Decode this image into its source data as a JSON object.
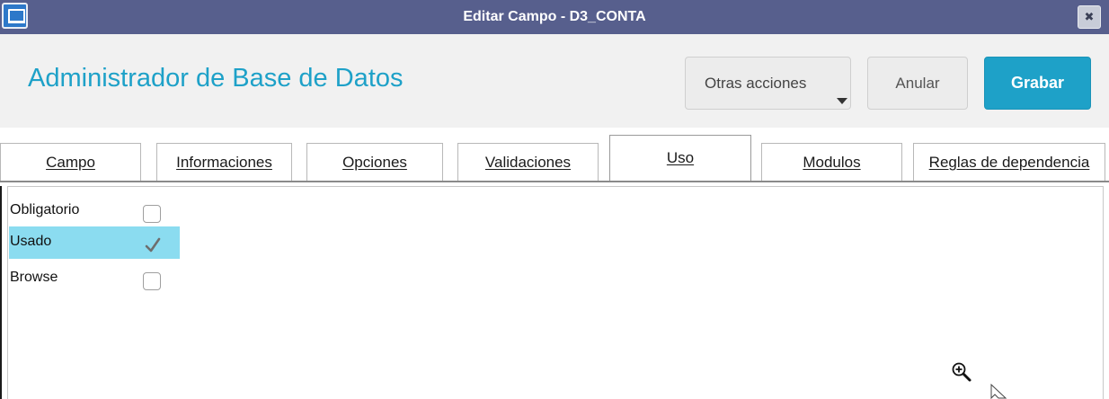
{
  "window": {
    "title": "Editar Campo - D3_CONTA",
    "close_label": "✖"
  },
  "header": {
    "title": "Administrador de Base de Datos",
    "buttons": {
      "more_actions": "Otras acciones",
      "cancel": "Anular",
      "save": "Grabar"
    }
  },
  "tabs": [
    {
      "label": "Campo",
      "active": false
    },
    {
      "label": "Informaciones",
      "active": false
    },
    {
      "label": "Opciones",
      "active": false
    },
    {
      "label": "Validaciones",
      "active": false
    },
    {
      "label": "Uso",
      "active": true
    },
    {
      "label": "Modulos",
      "active": false
    },
    {
      "label": "Reglas de dependencia",
      "active": false
    }
  ],
  "options": [
    {
      "label": "Obligatorio",
      "checked": false,
      "selected": false
    },
    {
      "label": "Usado",
      "checked": true,
      "selected": true
    },
    {
      "label": "Browse",
      "checked": false,
      "selected": false
    }
  ],
  "colors": {
    "titlebar": "#575f8d",
    "accent": "#1ea1c8",
    "selection": "#8bdcf0"
  },
  "icons": {
    "app": "window-app-icon",
    "close": "close-icon",
    "dropdown": "chevron-down-icon",
    "zoom": "zoom-in-icon",
    "cursor": "mouse-pointer-icon"
  }
}
